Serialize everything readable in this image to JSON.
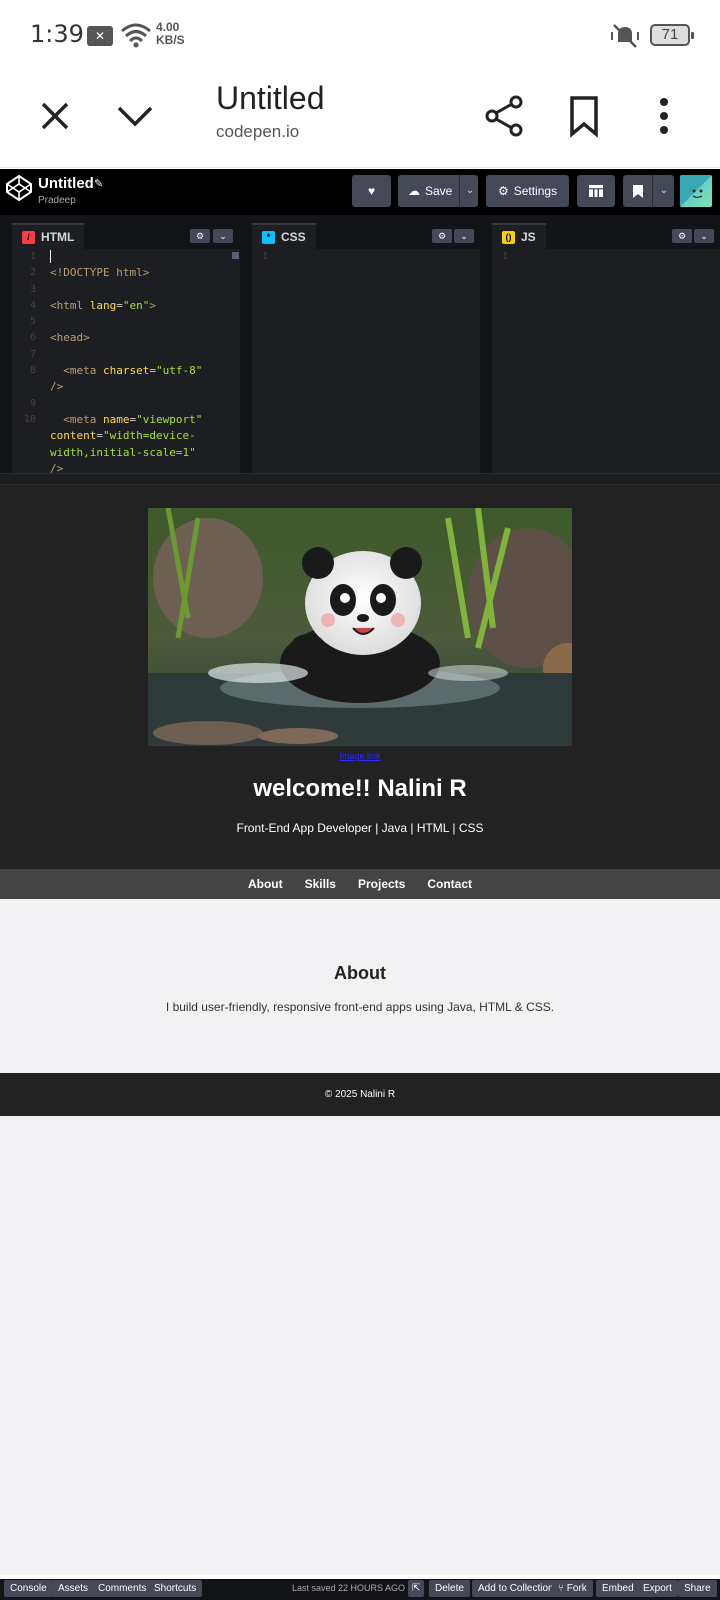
{
  "status_bar": {
    "time": "1:39",
    "speed_value": "4.00",
    "speed_unit": "KB/S",
    "battery": "71"
  },
  "custom_tab": {
    "title": "Untitled",
    "url": "codepen.io"
  },
  "codepen": {
    "pen_title": "Untitled",
    "user": "Pradeep",
    "save_label": "Save",
    "settings_label": "Settings"
  },
  "editors": {
    "html_label": "HTML",
    "css_label": "CSS",
    "js_label": "JS"
  },
  "preview": {
    "image_link": "Image link",
    "title": "welcome!! Nalini R",
    "subtitle": "Front-End App Developer | Java | HTML | CSS",
    "nav": [
      "About",
      "Skills",
      "Projects",
      "Contact"
    ],
    "about_title": "About",
    "about_text": "I build user-friendly, responsive front-end apps using Java, HTML & CSS.",
    "footer": "© 2025 Nalini R"
  },
  "bottom_bar": {
    "console": "Console",
    "assets": "Assets",
    "comments": "Comments",
    "shortcuts": "Shortcuts",
    "last_saved": "Last saved 22 HOURS AGO",
    "delete": "Delete",
    "add_to_collection": "Add to Collection",
    "fork": "Fork",
    "embed": "Embed",
    "export": "Export",
    "share": "Share"
  }
}
